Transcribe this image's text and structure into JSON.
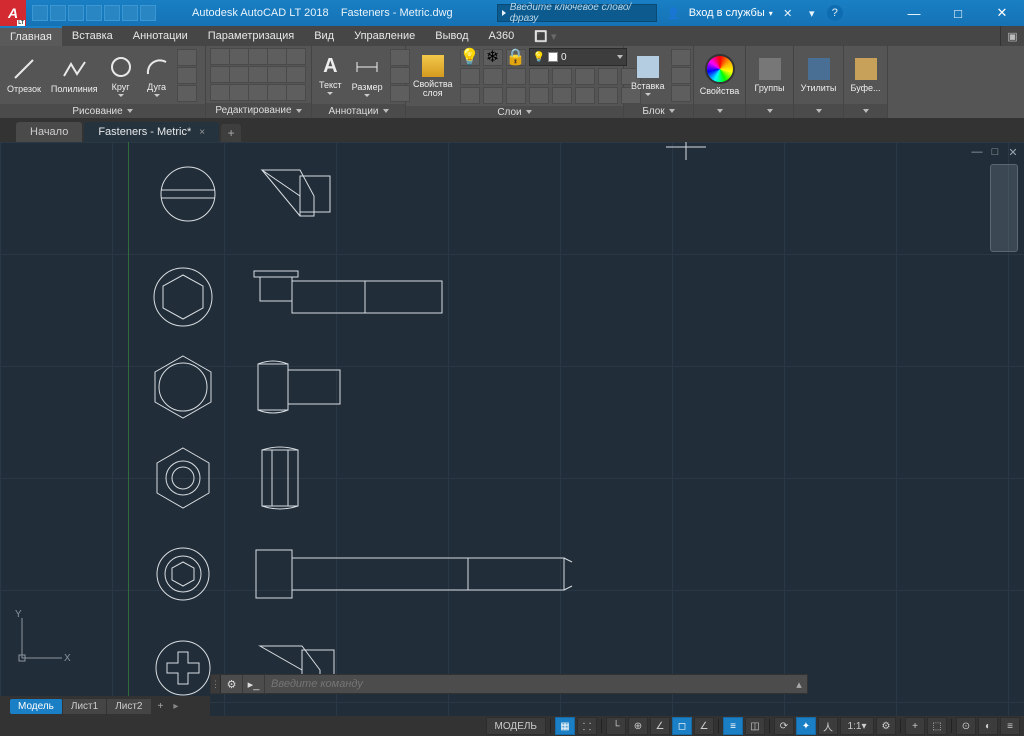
{
  "title": {
    "app": "Autodesk AutoCAD LT 2018",
    "file": "Fasteners - Metric.dwg"
  },
  "search": {
    "placeholder": "Введите ключевое слово/фразу"
  },
  "signin_label": "Вход в службы",
  "menu": {
    "items": [
      "Главная",
      "Вставка",
      "Аннотации",
      "Параметризация",
      "Вид",
      "Управление",
      "Вывод",
      "A360"
    ],
    "active_index": 0
  },
  "ribbon": {
    "draw": {
      "title": "Рисование",
      "btns": [
        "Отрезок",
        "Полилиния",
        "Круг",
        "Дуга"
      ]
    },
    "modify": {
      "title": "Редактирование"
    },
    "annot": {
      "title": "Аннотации",
      "btns": [
        "Текст",
        "Размер"
      ]
    },
    "layers": {
      "title": "Слои",
      "btn": "Свойства\nслоя",
      "current": "0"
    },
    "block": {
      "title": "Блок",
      "btn": "Вставка"
    },
    "props": {
      "title": "Свойства"
    },
    "groups": {
      "title": "Группы"
    },
    "utils": {
      "title": "Утилиты"
    },
    "clip": {
      "title": "Буфе..."
    }
  },
  "filetabs": {
    "start": "Начало",
    "active": "Fasteners - Metric*"
  },
  "cmd": {
    "placeholder": "Введите команду"
  },
  "layout": {
    "tabs": [
      "Модель",
      "Лист1",
      "Лист2"
    ]
  },
  "status": {
    "model": "МОДЕЛЬ",
    "scale": "1:1"
  }
}
